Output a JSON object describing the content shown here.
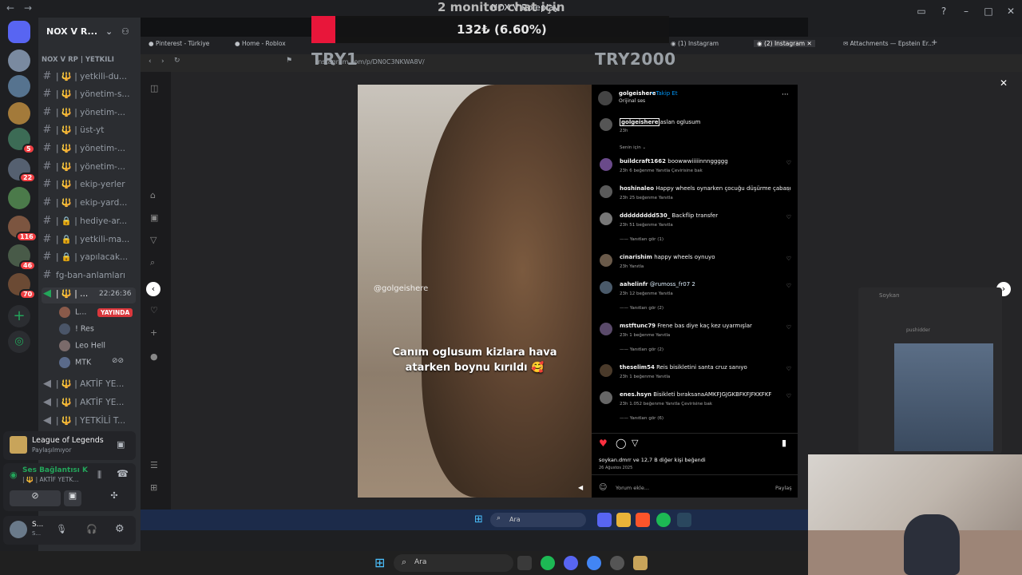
{
  "discord": {
    "window_title": "NOX V Roleplay",
    "server_name": "NOX V R...",
    "category": "NOX V RP | YETKİLİ",
    "channels": [
      {
        "name": "| 🔱 | yetkili-du...",
        "icon": "hash-icon"
      },
      {
        "name": "| 🔱 | yönetim-s...",
        "icon": "hash-icon"
      },
      {
        "name": "| 🔱 | yönetim-...",
        "icon": "hash-icon"
      },
      {
        "name": "| 🔱 | üst-yt",
        "icon": "hash-icon"
      },
      {
        "name": "| 🔱 | yönetim-...",
        "icon": "hash-icon"
      },
      {
        "name": "| 🔱 | yönetim-...",
        "icon": "hash-icon"
      },
      {
        "name": "| 🔱 | ekip-yerler",
        "icon": "hash-icon"
      },
      {
        "name": "| 🔱 | ekip-yard...",
        "icon": "hash-icon"
      },
      {
        "name": "| 🔒 | hediye-ar...",
        "icon": "hash-icon"
      },
      {
        "name": "| 🔒 | yetkili-ma...",
        "icon": "hash-icon"
      },
      {
        "name": "| 🔒 | yapılacak...",
        "icon": "hash-icon"
      },
      {
        "name": "fg-ban-anlamları",
        "icon": "hash-icon"
      }
    ],
    "active_voice": {
      "name": "| 🔱 | ...",
      "time": "22:26:36"
    },
    "voice_users": [
      {
        "name": "L...",
        "live": "YAYINDA"
      },
      {
        "name": "! Res"
      },
      {
        "name": "Leo Hell"
      },
      {
        "name": "MTK"
      }
    ],
    "voice_channels": [
      "| 🔱 | AKTİF YE...",
      "| 🔱 | AKTİF YE...",
      "| 🔱 | YETKİLİ T..."
    ],
    "activity": {
      "game": "League of Legends",
      "status": "Paylaşılmıyor"
    },
    "voice_connection": {
      "title": "Ses Bağlantısı K",
      "channel": "| 🔱 | AKTİF YETK..."
    },
    "user": {
      "name": "S...",
      "status": "S..."
    },
    "server_badges": [
      "5",
      "22",
      "116",
      "46",
      "70"
    ]
  },
  "overlay": {
    "title": "2 monitor chat için",
    "value": "132₺ (6.60%)",
    "left_label": "TRY1",
    "right_label": "TRY2000"
  },
  "browser": {
    "tabs": [
      "Pinterest - Türkiye",
      "Home - Roblox",
      "(1) Instagram",
      "(2) Instagram",
      "Attachments — Epstein Er..."
    ],
    "url": "instagram.com/p/DN0C3NKWA8V/"
  },
  "video": {
    "watermark": "@golgeishere",
    "caption_line1": "Canım oglusum kizlara hava",
    "caption_line2": "atarken boynu kırıldı 🥰"
  },
  "post": {
    "author": "golgeishere",
    "follow": "Takip Et",
    "sound": "Orijinal ses",
    "caption_user": "golgeishere",
    "caption_text": "aslan oglusum",
    "caption_time": "23h",
    "for_you": "Senin için",
    "comments": [
      {
        "user": "buildcraft1662",
        "text": "boowwwiiiiinnnggggg",
        "meta": "23h   6 beğenme   Yanıtla   Çevirisine bak"
      },
      {
        "user": "hoshinaleo",
        "text": "Happy wheels oynarken çocuğu düşürme çabası",
        "meta": "23h   25 beğenme   Yanıtla"
      },
      {
        "user": "ddddddddd530_",
        "text": "Backflip transfer",
        "meta": "23h   51 beğenme   Yanıtla",
        "replies": "Yanıtları gör (1)"
      },
      {
        "user": "cinarishim",
        "text": "happy wheels oynuyo",
        "meta": "23h   Yanıtla"
      },
      {
        "user": "aahelinfr",
        "text": "@rumoss_fr07 2",
        "meta": "23h   12 beğenme   Yanıtla",
        "replies": "Yanıtları gör (2)"
      },
      {
        "user": "mstftunc79",
        "text": "Frene bas diye kaç kez uyarmışlar",
        "meta": "23h   1 beğenme   Yanıtla",
        "replies": "Yanıtları gör (2)"
      },
      {
        "user": "theselim54",
        "text": "Reis bisikletini santa cruz sanıyo",
        "meta": "23h   1 beğenme   Yanıtla"
      },
      {
        "user": "enes.hsyn",
        "text": "Bisikleti bıraksanaAMKFJGJGKBFKFJFKKFKF",
        "meta": "23h   1.052 beğenme   Yanıtla   Çevirisine bak",
        "replies": "Yanıtları gör (6)"
      }
    ],
    "likes": "soykan.dmrr ve 12,7 B diğer kişi beğendi",
    "date": "26 Ağustos 2025",
    "comment_placeholder": "Yorum ekle...",
    "share": "Paylaş"
  },
  "side_card": {
    "name": "Soykan",
    "sub": "pushidder"
  },
  "inner_taskbar": {
    "search": "Ara"
  },
  "taskbar": {
    "search": "Ara"
  },
  "colors": {
    "accent_red": "#e8163a",
    "live_red": "#da373c",
    "insta_heart": "#ff3040",
    "discord_green": "#23a55a"
  }
}
